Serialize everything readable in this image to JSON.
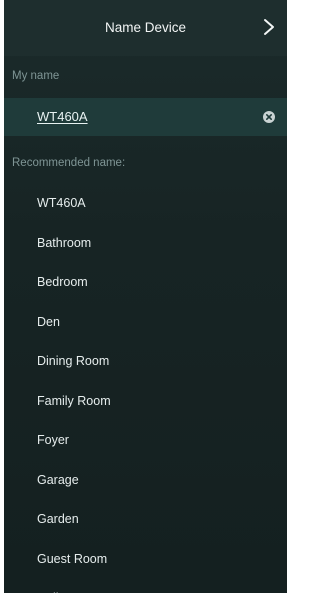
{
  "header": {
    "title": "Name Device",
    "next_icon": "chevron-right-icon"
  },
  "my_name": {
    "label": "My name",
    "value": "WT460A",
    "clear_icon": "clear-icon"
  },
  "recommended": {
    "label": "Recommended name:",
    "items": [
      "WT460A",
      "Bathroom",
      "Bedroom",
      "Den",
      "Dining Room",
      "Family Room",
      "Foyer",
      "Garage",
      "Garden",
      "Guest Room",
      "Hallway"
    ]
  },
  "colors": {
    "background": "#172424",
    "header": "#1e2e2e",
    "selected_row": "#1f3b3a",
    "label_text": "#7f9595",
    "text": "#e6eded"
  }
}
